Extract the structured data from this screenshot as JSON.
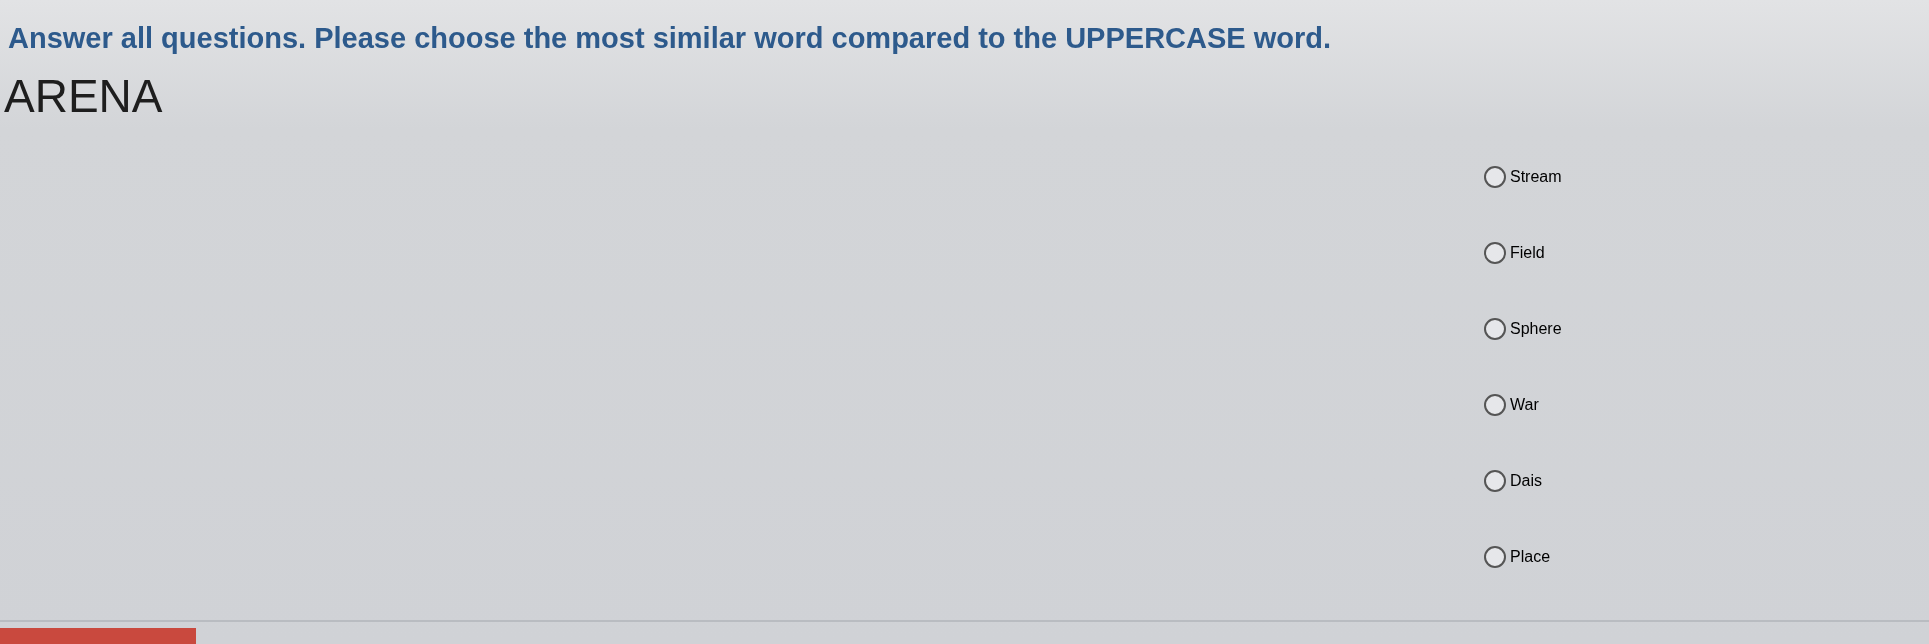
{
  "instruction": "Answer all questions. Please choose the most similar word compared to the UPPERCASE word.",
  "question": {
    "word": "ARENA",
    "options": [
      {
        "label": "Stream",
        "selected": false
      },
      {
        "label": "Field",
        "selected": false
      },
      {
        "label": "Sphere",
        "selected": false
      },
      {
        "label": "War",
        "selected": false
      },
      {
        "label": "Dais",
        "selected": false
      },
      {
        "label": "Place",
        "selected": false
      }
    ]
  }
}
